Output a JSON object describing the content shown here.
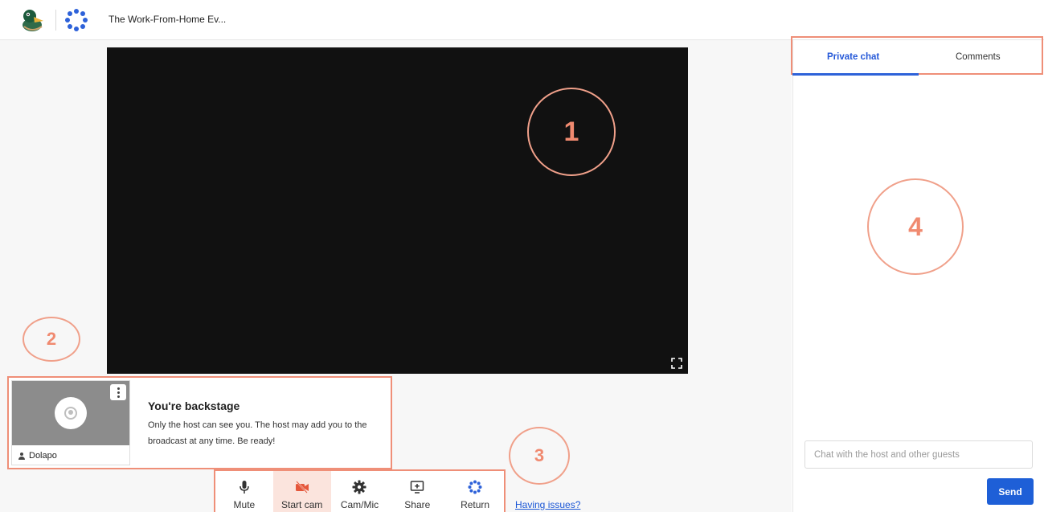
{
  "header": {
    "event_title": "The Work-From-Home Ev..."
  },
  "annotations": {
    "one": "1",
    "two": "2",
    "three": "3",
    "four": "4"
  },
  "backstage": {
    "participant_name": "Dolapo",
    "title": "You're backstage",
    "message": "Only the host can see you. The host may add you to the broadcast at any time. Be ready!"
  },
  "toolbar": {
    "buttons": [
      {
        "label": "Mute",
        "icon": "microphone-icon"
      },
      {
        "label": "Start cam",
        "icon": "camera-off-icon",
        "active": true
      },
      {
        "label": "Cam/Mic",
        "icon": "gear-icon"
      },
      {
        "label": "Share",
        "icon": "screen-share-icon"
      },
      {
        "label": "Return",
        "icon": "return-spinner-icon"
      }
    ],
    "issues_link": "Having issues?"
  },
  "chat": {
    "tabs": [
      {
        "label": "Private chat",
        "selected": true
      },
      {
        "label": "Comments",
        "selected": false
      }
    ],
    "input_placeholder": "Chat with the host and other guests",
    "send_label": "Send"
  },
  "colors": {
    "accent": "#1e5fd7",
    "annotation": "#ef8f78",
    "video_bg": "#111111",
    "active_button_bg": "#fbe4dd"
  }
}
